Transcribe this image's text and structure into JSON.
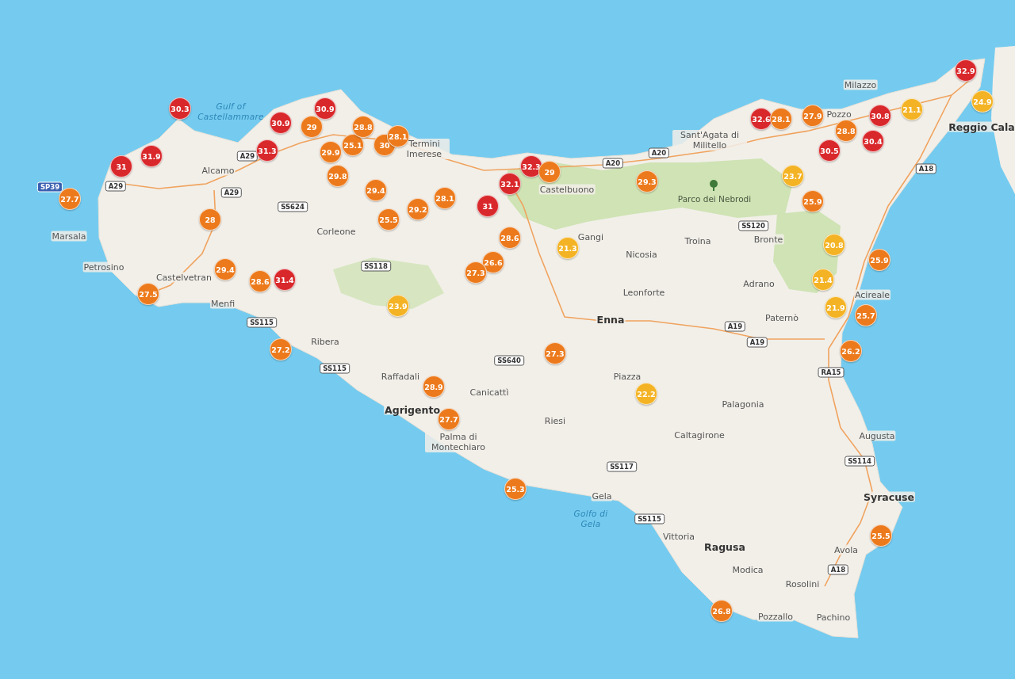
{
  "map": {
    "sea_labels": [
      "Gulf of Castellammare",
      "Golfo di Gela"
    ],
    "park_label": "Parco dei Nebrodi",
    "places": [
      {
        "name": "Marsala",
        "kind": "town"
      },
      {
        "name": "Alcamo",
        "kind": "town"
      },
      {
        "name": "Corleone",
        "kind": "town"
      },
      {
        "name": "Termini Imerese",
        "kind": "town"
      },
      {
        "name": "Petrosino",
        "kind": "town"
      },
      {
        "name": "Castelvetran",
        "kind": "town"
      },
      {
        "name": "Menfi",
        "kind": "town"
      },
      {
        "name": "Ribera",
        "kind": "town"
      },
      {
        "name": "Raffadali",
        "kind": "town"
      },
      {
        "name": "Agrigento",
        "kind": "city"
      },
      {
        "name": "Canicattì",
        "kind": "town"
      },
      {
        "name": "Palma di Montechiaro",
        "kind": "town"
      },
      {
        "name": "Riesi",
        "kind": "town"
      },
      {
        "name": "Caltagirone",
        "kind": "town"
      },
      {
        "name": "Gela",
        "kind": "town"
      },
      {
        "name": "Vittoria",
        "kind": "town"
      },
      {
        "name": "Ragusa",
        "kind": "city"
      },
      {
        "name": "Modica",
        "kind": "town"
      },
      {
        "name": "Pozzallo",
        "kind": "town"
      },
      {
        "name": "Rosolini",
        "kind": "town"
      },
      {
        "name": "Pachino",
        "kind": "town"
      },
      {
        "name": "Avola",
        "kind": "town"
      },
      {
        "name": "Augusta",
        "kind": "town"
      },
      {
        "name": "Syracuse",
        "kind": "city"
      },
      {
        "name": "Palagonia",
        "kind": "town"
      },
      {
        "name": "Paternò",
        "kind": "town"
      },
      {
        "name": "Adrano",
        "kind": "town"
      },
      {
        "name": "Leonforte",
        "kind": "town"
      },
      {
        "name": "Enna",
        "kind": "city"
      },
      {
        "name": "Gangi",
        "kind": "town"
      },
      {
        "name": "Troina",
        "kind": "town"
      },
      {
        "name": "Bronte",
        "kind": "town"
      },
      {
        "name": "Nicosia",
        "kind": "town"
      },
      {
        "name": "Castelbuono",
        "kind": "town"
      },
      {
        "name": "Sant'Agata di Militello",
        "kind": "town"
      },
      {
        "name": "Milazzo",
        "kind": "town"
      },
      {
        "name": "Pozzo",
        "kind": "town"
      },
      {
        "name": "Reggio Cala",
        "kind": "city"
      },
      {
        "name": "Piazza",
        "kind": "town"
      },
      {
        "name": "Acireale",
        "kind": "town"
      }
    ],
    "road_shields": [
      {
        "label": "SP39",
        "kind": "provincial"
      },
      {
        "label": "A29",
        "kind": "motorway"
      },
      {
        "label": "A29",
        "kind": "motorway"
      },
      {
        "label": "A29",
        "kind": "motorway"
      },
      {
        "label": "SS624",
        "kind": "motorway"
      },
      {
        "label": "SS118",
        "kind": "motorway"
      },
      {
        "label": "SS115",
        "kind": "motorway"
      },
      {
        "label": "SS115",
        "kind": "motorway"
      },
      {
        "label": "SS640",
        "kind": "motorway"
      },
      {
        "label": "A20",
        "kind": "motorway"
      },
      {
        "label": "A20",
        "kind": "motorway"
      },
      {
        "label": "SS120",
        "kind": "motorway"
      },
      {
        "label": "A18",
        "kind": "motorway"
      },
      {
        "label": "A19",
        "kind": "motorway"
      },
      {
        "label": "A19",
        "kind": "motorway"
      },
      {
        "label": "RA15",
        "kind": "motorway"
      },
      {
        "label": "SS114",
        "kind": "motorway"
      },
      {
        "label": "SS117",
        "kind": "motorway"
      },
      {
        "label": "SS115",
        "kind": "motorway"
      },
      {
        "label": "A18",
        "kind": "motorway"
      }
    ],
    "temperature_markers": [
      {
        "value": "30.3",
        "color": "#d9282b"
      },
      {
        "value": "31.9",
        "color": "#d9282b"
      },
      {
        "value": "31",
        "color": "#d9282b"
      },
      {
        "value": "27.7",
        "color": "#ec7a1c"
      },
      {
        "value": "30.9",
        "color": "#d9282b"
      },
      {
        "value": "30.9",
        "color": "#d9282b"
      },
      {
        "value": "29",
        "color": "#ec7a1c"
      },
      {
        "value": "31.3",
        "color": "#d9282b"
      },
      {
        "value": "25.1",
        "color": "#ec7a1c"
      },
      {
        "value": "30",
        "color": "#ec7a1c"
      },
      {
        "value": "28.1",
        "color": "#ec7a1c"
      },
      {
        "value": "28.8",
        "color": "#ec7a1c"
      },
      {
        "value": "29.9",
        "color": "#ec7a1c"
      },
      {
        "value": "29.8",
        "color": "#ec7a1c"
      },
      {
        "value": "29.4",
        "color": "#ec7a1c"
      },
      {
        "value": "28.1",
        "color": "#ec7a1c"
      },
      {
        "value": "29.2",
        "color": "#ec7a1c"
      },
      {
        "value": "25.5",
        "color": "#ec7a1c"
      },
      {
        "value": "28",
        "color": "#ec7a1c"
      },
      {
        "value": "31",
        "color": "#d9282b"
      },
      {
        "value": "32.1",
        "color": "#d9282b"
      },
      {
        "value": "32.3",
        "color": "#d9282b"
      },
      {
        "value": "29",
        "color": "#ec7a1c"
      },
      {
        "value": "28.6",
        "color": "#ec7a1c"
      },
      {
        "value": "26.6",
        "color": "#ec7a1c"
      },
      {
        "value": "27.3",
        "color": "#ec7a1c"
      },
      {
        "value": "21.3",
        "color": "#f4b324"
      },
      {
        "value": "29.3",
        "color": "#ec7a1c"
      },
      {
        "value": "29.4",
        "color": "#ec7a1c"
      },
      {
        "value": "28.6",
        "color": "#ec7a1c"
      },
      {
        "value": "31.4",
        "color": "#d9282b"
      },
      {
        "value": "27.5",
        "color": "#ec7a1c"
      },
      {
        "value": "23.9",
        "color": "#f4b324"
      },
      {
        "value": "27.2",
        "color": "#ec7a1c"
      },
      {
        "value": "28.9",
        "color": "#ec7a1c"
      },
      {
        "value": "27.7",
        "color": "#ec7a1c"
      },
      {
        "value": "27.3",
        "color": "#ec7a1c"
      },
      {
        "value": "25.3",
        "color": "#ec7a1c"
      },
      {
        "value": "22.2",
        "color": "#f4b324"
      },
      {
        "value": "26.8",
        "color": "#ec7a1c"
      },
      {
        "value": "25.5",
        "color": "#ec7a1c"
      },
      {
        "value": "26.2",
        "color": "#ec7a1c"
      },
      {
        "value": "25.7",
        "color": "#ec7a1c"
      },
      {
        "value": "21.9",
        "color": "#f4b324"
      },
      {
        "value": "21.4",
        "color": "#f4b324"
      },
      {
        "value": "20.8",
        "color": "#f4b324"
      },
      {
        "value": "25.9",
        "color": "#ec7a1c"
      },
      {
        "value": "25.9",
        "color": "#ec7a1c"
      },
      {
        "value": "23.7",
        "color": "#f4b324"
      },
      {
        "value": "30.5",
        "color": "#d9282b"
      },
      {
        "value": "28.8",
        "color": "#ec7a1c"
      },
      {
        "value": "30.4",
        "color": "#d9282b"
      },
      {
        "value": "30.8",
        "color": "#d9282b"
      },
      {
        "value": "21.1",
        "color": "#f4b324"
      },
      {
        "value": "32.6",
        "color": "#d9282b"
      },
      {
        "value": "28.1",
        "color": "#ec7a1c"
      },
      {
        "value": "27.9",
        "color": "#ec7a1c"
      },
      {
        "value": "32.9",
        "color": "#d9282b"
      },
      {
        "value": "24.9",
        "color": "#f4b324"
      }
    ]
  }
}
